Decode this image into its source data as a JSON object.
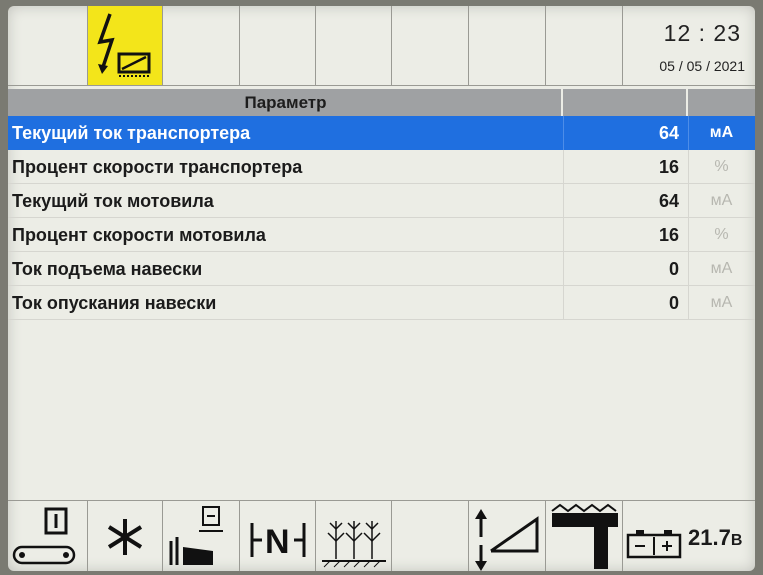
{
  "clock": {
    "time": "12 : 23",
    "date": "05 / 05 / 2021"
  },
  "header": {
    "parameter_label": "Параметр"
  },
  "rows": [
    {
      "label": "Текущий ток транспортера",
      "value": "64",
      "unit": "мА",
      "selected": true
    },
    {
      "label": "Процент скорости транспортера",
      "value": "16",
      "unit": "%",
      "selected": false
    },
    {
      "label": "Текущий ток мотовила",
      "value": "64",
      "unit": "мА",
      "selected": false
    },
    {
      "label": "Процент скорости мотовила",
      "value": "16",
      "unit": "%",
      "selected": false
    },
    {
      "label": "Ток подъема навески",
      "value": "0",
      "unit": "мА",
      "selected": false
    },
    {
      "label": "Ток опускания навески",
      "value": "0",
      "unit": "мА",
      "selected": false
    }
  ],
  "top_icons": [
    "lightning-calibration-icon",
    "empty-slot",
    "empty-slot",
    "empty-slot",
    "empty-slot",
    "empty-slot",
    "empty-slot"
  ],
  "bottom_icons": [
    "conveyor-icon",
    "fan-asterisk-icon",
    "grain-unloader-icon",
    "neutral-gear-icon",
    "crop-row-icon",
    "empty-slot",
    "header-lift-icon",
    "header-height-icon",
    "battery-icon"
  ],
  "battery": {
    "value": "21.7",
    "unit": "В"
  },
  "colors": {
    "selection": "#1f6fe0",
    "active_tab": "#f3e51a",
    "header_bg": "#9fa1a3",
    "screen_bg": "#ecede6"
  }
}
